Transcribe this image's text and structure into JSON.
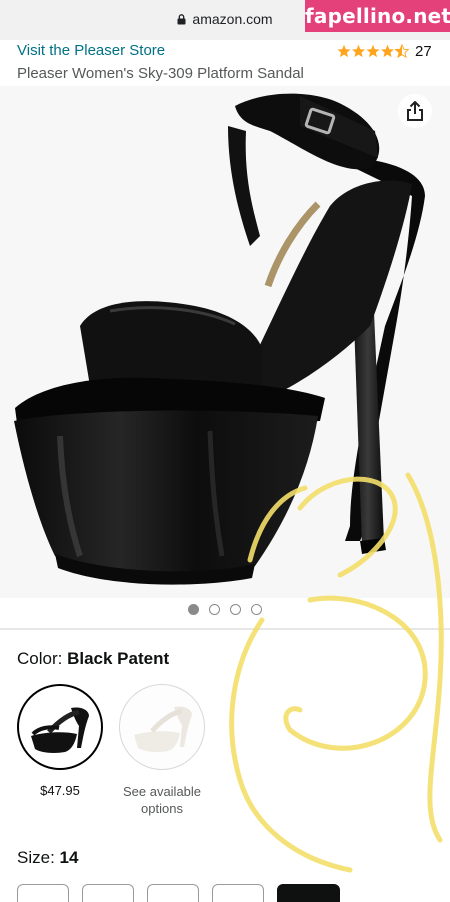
{
  "browser": {
    "url": "amazon.com"
  },
  "watermark": "fapellino.net",
  "product": {
    "store_link": "Visit the Pleaser Store",
    "rating_count": "27",
    "rating_stars": 4.5,
    "title": "Pleaser Women's Sky-309 Platform Sandal",
    "image_pages": 4,
    "active_image": 1
  },
  "color": {
    "label": "Color:",
    "value": "Black Patent",
    "swatches": [
      {
        "price": "$47.95"
      },
      {
        "note": "See available options"
      }
    ]
  },
  "size": {
    "label": "Size:",
    "value": "14"
  },
  "colors": {
    "link": "#007185",
    "annotation": "#f3df6a",
    "watermark_bg": "#e4407a",
    "star": "#ffa41c"
  }
}
